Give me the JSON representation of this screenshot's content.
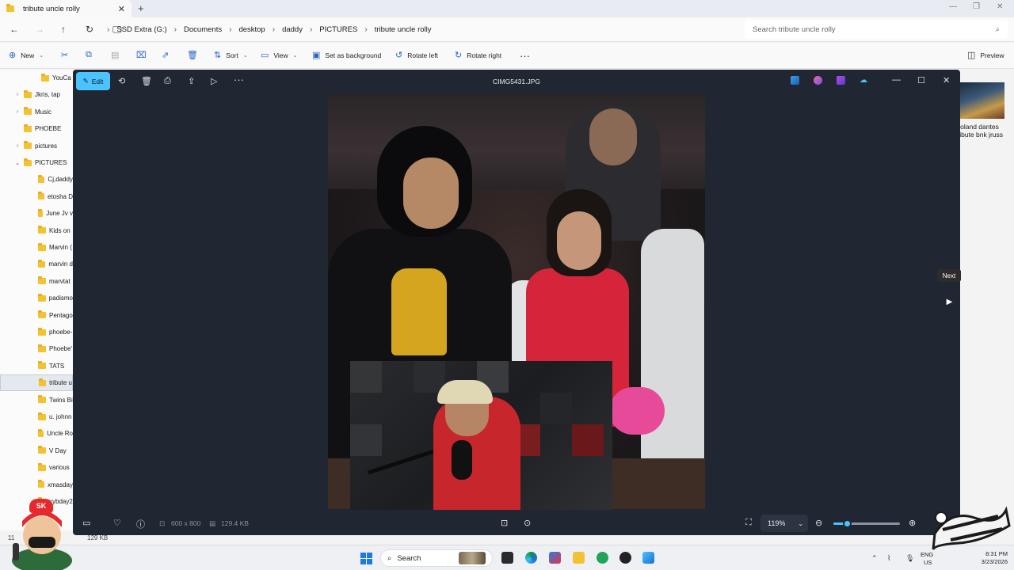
{
  "explorer": {
    "tab_title": "tribute uncle rolly",
    "breadcrumb": [
      "SSD Extra (G:)",
      "Documents",
      "desktop",
      "daddy",
      "PICTURES",
      "tribute uncle rolly"
    ],
    "search_placeholder": "Search tribute uncle rolly",
    "commands": {
      "new": "New",
      "sort": "Sort",
      "view": "View",
      "set_background": "Set as background",
      "rotate_left": "Rotate left",
      "rotate_right": "Rotate right",
      "preview": "Preview"
    },
    "nav_items": [
      {
        "label": "YouCa",
        "chevron": ""
      },
      {
        "label": "Jkris, tap",
        "chevron": "›"
      },
      {
        "label": "Music",
        "chevron": "›"
      },
      {
        "label": "PHOEBE",
        "chevron": ""
      },
      {
        "label": "pictures",
        "chevron": "›"
      },
      {
        "label": "PICTURES",
        "chevron": "⌄"
      },
      {
        "label": "Cj,daddy",
        "chevron": ""
      },
      {
        "label": "etosha D",
        "chevron": ""
      },
      {
        "label": "June Jv v",
        "chevron": ""
      },
      {
        "label": "Kids on",
        "chevron": ""
      },
      {
        "label": "Marvin (",
        "chevron": ""
      },
      {
        "label": "marvin d",
        "chevron": ""
      },
      {
        "label": "marvtat",
        "chevron": ""
      },
      {
        "label": "padismo",
        "chevron": ""
      },
      {
        "label": "Pentago",
        "chevron": ""
      },
      {
        "label": "phoebe-",
        "chevron": ""
      },
      {
        "label": "Phoebe'",
        "chevron": ""
      },
      {
        "label": "TATS",
        "chevron": ""
      },
      {
        "label": "tribute u",
        "chevron": "",
        "selected": true
      },
      {
        "label": "Twins Bi",
        "chevron": ""
      },
      {
        "label": "u. johnn",
        "chevron": ""
      },
      {
        "label": "Uncle Ro",
        "chevron": ""
      },
      {
        "label": "V Day",
        "chevron": ""
      },
      {
        "label": "various",
        "chevron": ""
      },
      {
        "label": "xmasday",
        "chevron": ""
      },
      {
        "label": "xybday2",
        "chevron": ""
      }
    ],
    "thumbnail_caption": "Roland dantes tribute bnk jruss",
    "status_items": "11",
    "status_size": "129 KB"
  },
  "viewer": {
    "edit_label": "Edit",
    "file_title": "CIMG5431.JPG",
    "dimensions": "600 x 800",
    "file_size": "129.4 KB",
    "zoom": "119%",
    "zoom_fraction": 0.2,
    "next_tooltip": "Next"
  },
  "taskbar": {
    "search_label": "Search",
    "lang_top": "ENG",
    "lang_bottom": "US",
    "time": "8:31 PM",
    "date": "3/23/2026"
  },
  "overlay": {
    "badge": "SK"
  },
  "colors": {
    "accent": "#4cc2ff",
    "viewer_bg": "#202733",
    "folder": "#f2c232"
  }
}
